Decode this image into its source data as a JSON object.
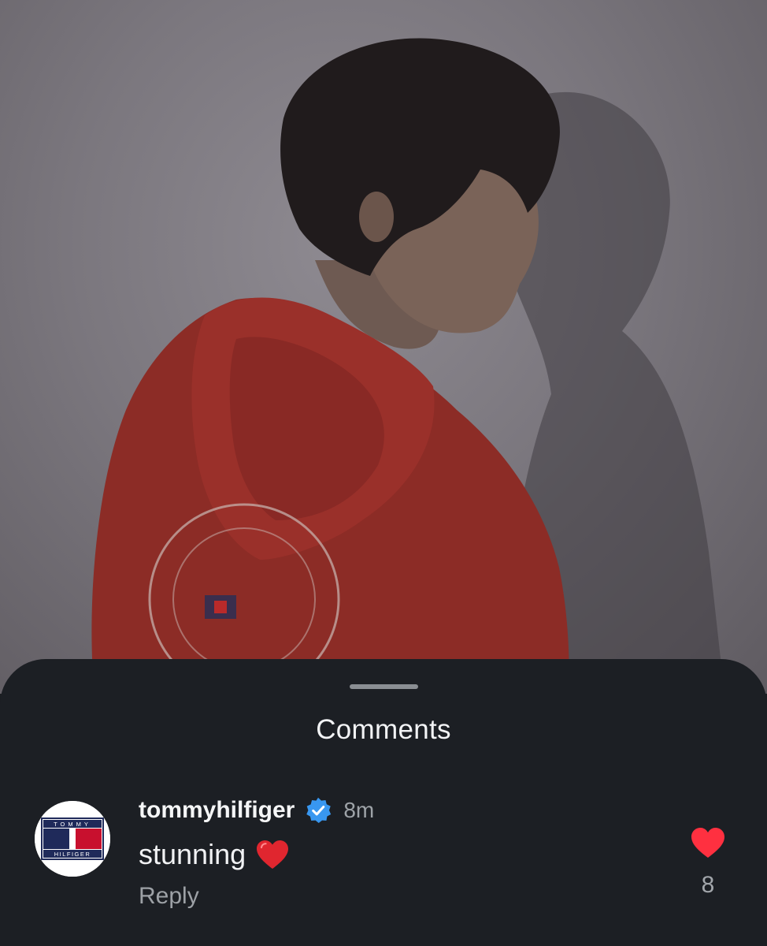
{
  "sheet": {
    "title": "Comments"
  },
  "comment": {
    "avatar_icon": "tommy-hilfiger-logo",
    "avatar_logo_top": "TOMMY",
    "avatar_logo_bottom": "HILFIGER",
    "username": "tommyhilfiger",
    "verified_icon": "verified-badge-icon",
    "timestamp": "8m",
    "text": "stunning",
    "text_emoji": "red-heart-emoji",
    "reply_label": "Reply",
    "like_icon": "heart-icon",
    "like_count": "8"
  },
  "colors": {
    "sheet_background": "#1c1f24",
    "verified_blue": "#3897f0",
    "like_red": "#ff3040",
    "muted_text": "#9ea3a8"
  }
}
